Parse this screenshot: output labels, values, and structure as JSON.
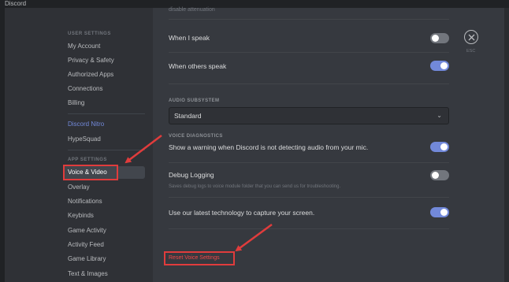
{
  "window": {
    "title": "Discord"
  },
  "sidebar": {
    "user_settings_header": "USER SETTINGS",
    "user_items": [
      {
        "label": "My Account"
      },
      {
        "label": "Privacy & Safety"
      },
      {
        "label": "Authorized Apps"
      },
      {
        "label": "Connections"
      },
      {
        "label": "Billing"
      }
    ],
    "nitro_items": [
      {
        "label": "Discord Nitro"
      },
      {
        "label": "HypeSquad"
      }
    ],
    "app_settings_header": "APP SETTINGS",
    "app_items": [
      {
        "label": "Voice & Video",
        "selected": true
      },
      {
        "label": "Overlay"
      },
      {
        "label": "Notifications"
      },
      {
        "label": "Keybinds"
      },
      {
        "label": "Game Activity"
      },
      {
        "label": "Activity Feed"
      },
      {
        "label": "Game Library"
      },
      {
        "label": "Text & Images"
      }
    ]
  },
  "content": {
    "top_partial_text": "disable attenuation",
    "rows": [
      {
        "label": "When I speak",
        "on": false
      },
      {
        "label": "When others speak",
        "on": true
      }
    ],
    "audio_subsystem": {
      "header": "AUDIO SUBSYSTEM",
      "value": "Standard"
    },
    "voice_diagnostics": {
      "header": "VOICE DIAGNOSTICS",
      "label": "Show a warning when Discord is not detecting audio from your mic.",
      "on": true
    },
    "debug_logging": {
      "label": "Debug Logging",
      "sub": "Saves debug logs to voice module folder that you can send us for troubleshooting.",
      "on": false
    },
    "capture": {
      "label": "Use our latest technology to capture your screen.",
      "on": true
    },
    "reset_label": "Reset Voice Settings",
    "esc_label": "ESC"
  },
  "colors": {
    "accent": "#7289da",
    "danger": "#f04747",
    "annotation": "#e03c3c"
  },
  "icons": {
    "close": "close-icon",
    "dropdown": "chevron-down-icon"
  }
}
